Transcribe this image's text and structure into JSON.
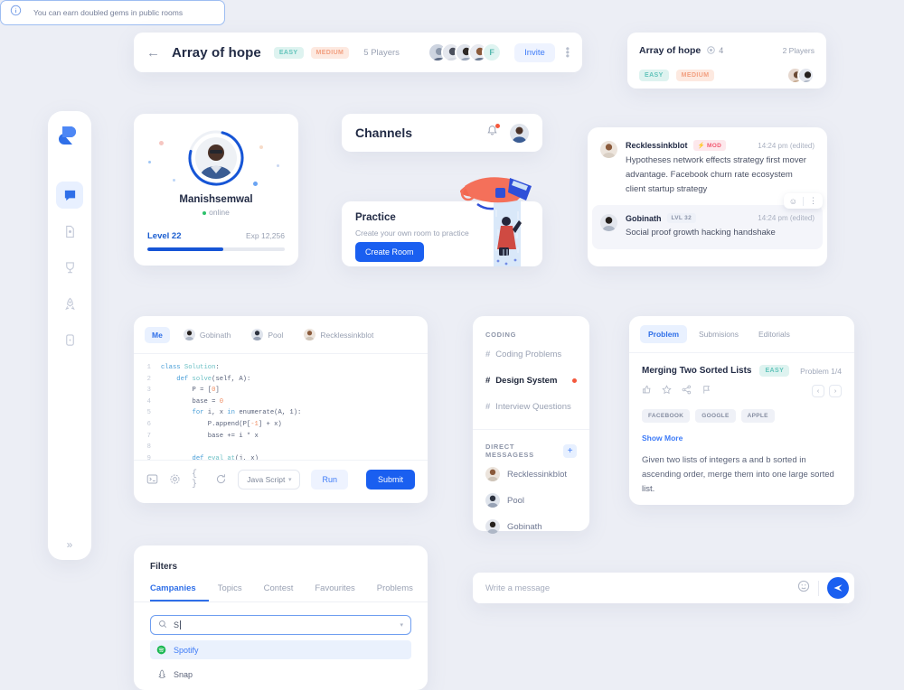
{
  "sidebar": {
    "logo": "logo-icon",
    "items": [
      {
        "icon": "chat-icon",
        "name": "chat",
        "active": true
      },
      {
        "icon": "file-icon",
        "name": "files",
        "active": false
      },
      {
        "icon": "trophy-icon",
        "name": "leaderboard",
        "active": false
      },
      {
        "icon": "rocket-icon",
        "name": "launch",
        "active": false
      },
      {
        "icon": "device-icon",
        "name": "device",
        "active": false
      }
    ],
    "expand": "»"
  },
  "topbar": {
    "back": "←",
    "title": "Array of hope",
    "difficulty_easy": "EASY",
    "difficulty_medium": "MEDIUM",
    "players": "5 Players",
    "avatar_letter": "F",
    "invite_label": "Invite",
    "menu": "more-vertical-icon"
  },
  "minicard": {
    "title": "Array of hope",
    "gem_icon": "gem-icon",
    "gem_count": "4",
    "players": "2 Players",
    "difficulty_easy": "EASY",
    "difficulty_medium": "MEDIUM"
  },
  "profile": {
    "name": "Manishsemwal",
    "status": "online",
    "level": "Level 22",
    "exp": "Exp 12,256",
    "progress_percent": 55
  },
  "channels": {
    "title": "Channels",
    "bell_icon": "bell-icon",
    "avatar": "user-avatar"
  },
  "practice": {
    "title": "Practice",
    "subtitle": "Create your own room to practice",
    "button": "Create Room"
  },
  "chat": {
    "messages": [
      {
        "author": "Recklessinkblot",
        "badge": "MOD",
        "badge_type": "mod",
        "time": "14:24 pm (edited)",
        "text": "Hypotheses network effects strategy first mover advantage. Facebook churn rate ecosystem client startup strategy",
        "highlighted": false
      },
      {
        "author": "Gobinath",
        "badge": "LVL 32",
        "badge_type": "lvl",
        "time": "14:24 pm (edited)",
        "text": "Social proof growth hacking handshake",
        "highlighted": true
      }
    ],
    "react_emoji": "☺",
    "react_more": "⋮"
  },
  "editor": {
    "tabs": [
      {
        "label": "Me",
        "active": true
      },
      {
        "label": "Gobinath",
        "active": false
      },
      {
        "label": "Pool",
        "active": false
      },
      {
        "label": "Recklessinkblot",
        "active": false
      }
    ],
    "code_lines": [
      {
        "n": "1",
        "html": "<span class='kw'>class</span> <span class='fn'>Solution</span>:"
      },
      {
        "n": "2",
        "html": "    <span class='kw'>def</span> <span class='fn'>solve</span>(self, A):"
      },
      {
        "n": "3",
        "html": "        P = [<span class='num'>0</span>]"
      },
      {
        "n": "4",
        "html": "        base = <span class='num'>0</span>"
      },
      {
        "n": "5",
        "html": "        <span class='kw'>for</span> i, x <span class='kw'>in</span> enumerate(A, 1):"
      },
      {
        "n": "6",
        "html": "            P.append(P[<span class='num'>-1</span>] + x)"
      },
      {
        "n": "7",
        "html": "            base += i * x"
      },
      {
        "n": "8",
        "html": ""
      },
      {
        "n": "9",
        "html": "        <span class='kw'>def</span> <span class='fn'>eval_at</span>(j, x)"
      }
    ],
    "toolbar": {
      "terminal_icon": "terminal-icon",
      "settings_icon": "gear-icon",
      "braces_icon": "{ }",
      "reset_icon": "refresh-icon",
      "language": "Java Script",
      "run_label": "Run",
      "submit_label": "Submit"
    }
  },
  "channel_nav": {
    "section_coding": "CODING",
    "channels": [
      {
        "label": "Coding Problems",
        "active": false,
        "dot": false
      },
      {
        "label": "Design System",
        "active": true,
        "dot": true
      },
      {
        "label": "Interview Questions",
        "active": false,
        "dot": false
      }
    ],
    "section_dm": "DIRECT MESSAGESS",
    "add_label": "+",
    "dms": [
      {
        "label": "Recklessinkblot"
      },
      {
        "label": "Pool"
      },
      {
        "label": "Gobinath"
      }
    ]
  },
  "problem": {
    "tabs": [
      {
        "label": "Problem",
        "active": true
      },
      {
        "label": "Submisions",
        "active": false
      },
      {
        "label": "Editorials",
        "active": false
      }
    ],
    "title": "Merging Two Sorted Lists",
    "difficulty": "EASY",
    "counter": "Problem 1/4",
    "actions": [
      "thumbs-up-icon",
      "star-icon",
      "share-icon",
      "flag-icon"
    ],
    "prev": "‹",
    "next": "›",
    "tags": [
      "FACEBOOK",
      "GOOGLE",
      "APPLE"
    ],
    "show_more": "Show More",
    "description": "Given two lists of integers a and b sorted in ascending order, merge them into one large sorted list."
  },
  "hint": {
    "icon": "info-icon",
    "text": "You can earn doubled gems in public rooms"
  },
  "message_input": {
    "placeholder": "Write a message",
    "emoji_icon": "smiley-icon",
    "send_icon": "send-icon"
  },
  "filters": {
    "title": "Filters",
    "tabs": [
      {
        "label": "Campanies",
        "active": true
      },
      {
        "label": "Topics",
        "active": false
      },
      {
        "label": "Contest",
        "active": false
      },
      {
        "label": "Favourites",
        "active": false
      },
      {
        "label": "Problems",
        "active": false
      }
    ],
    "search_value": "S",
    "search_icon": "search-icon",
    "options": [
      {
        "label": "Spotify",
        "icon": "spotify-icon",
        "selected": true
      },
      {
        "label": "Snap",
        "icon": "snapchat-icon",
        "selected": false
      }
    ]
  },
  "colors": {
    "accent": "#1a5ff0",
    "accent_soft": "#eef3ff",
    "bg": "#eceef5",
    "easy": "#63c4bb",
    "medium": "#f2a081",
    "mod": "#f1566f",
    "online": "#2ec16b",
    "spotify": "#1db954"
  }
}
